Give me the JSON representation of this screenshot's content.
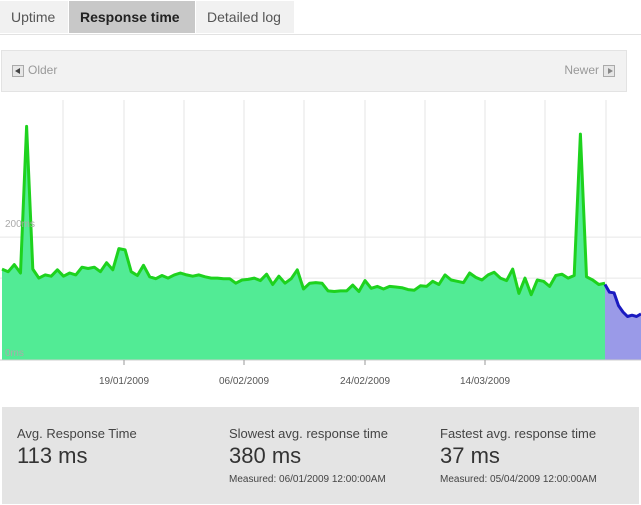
{
  "tabs": [
    {
      "label": "Uptime",
      "active": false
    },
    {
      "label": "Response time",
      "active": true
    },
    {
      "label": "Detailed log",
      "active": false
    }
  ],
  "pager": {
    "older": "Older",
    "newer": "Newer"
  },
  "colors": {
    "series_fill": "#52eb95",
    "series_line": "#1ed21e",
    "recent_fill": "#9a9ae8",
    "recent_line": "#1a1ac0"
  },
  "chart_data": {
    "type": "area",
    "y_tick_labels": [
      "200ms",
      "0ms"
    ],
    "x_tick_labels": [
      "19/01/2009",
      "06/02/2009",
      "24/02/2009",
      "14/03/2009"
    ],
    "series": [
      {
        "values": [
          142,
          138,
          149,
          136,
          365,
          142,
          128,
          133,
          131,
          141,
          131,
          136,
          133,
          145,
          143,
          145,
          138,
          152,
          141,
          174,
          172,
          138,
          132,
          148,
          130,
          127,
          132,
          128,
          133,
          136,
          133,
          131,
          133,
          130,
          128,
          128,
          127,
          127,
          120,
          125,
          126,
          128,
          124,
          134,
          118,
          131,
          120,
          127,
          141,
          111,
          120,
          121,
          120,
          108,
          107,
          108,
          108,
          117,
          107,
          124,
          112,
          115,
          111,
          115,
          114,
          113,
          110,
          109,
          116,
          115,
          123,
          118,
          133,
          125,
          123,
          121,
          136,
          129,
          125,
          133,
          137,
          128,
          124,
          142,
          104,
          128,
          102,
          125,
          123,
          115,
          132,
          134,
          128,
          132,
          353,
          130,
          125,
          118,
          120
        ]
      },
      {
        "values": [
          118,
          106,
          105,
          85,
          75,
          68,
          70,
          68,
          72
        ]
      }
    ]
  },
  "summary": [
    {
      "label": "Avg. Response Time",
      "value": "113 ms",
      "measured": ""
    },
    {
      "label": "Slowest avg. response time",
      "value": "380 ms",
      "measured": "Measured: 06/01/2009 12:00:00AM"
    },
    {
      "label": "Fastest avg. response time",
      "value": "37 ms",
      "measured": "Measured: 05/04/2009 12:00:00AM"
    }
  ]
}
